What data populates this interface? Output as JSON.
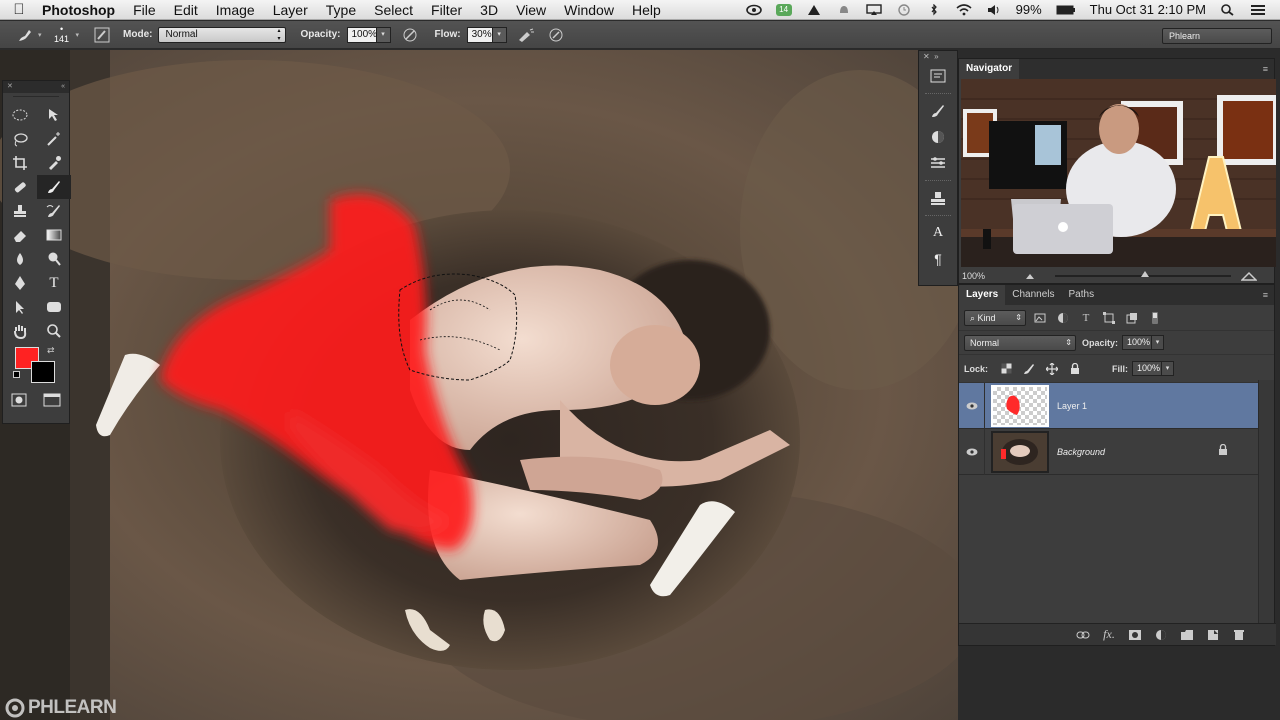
{
  "menubar": {
    "app": "Photoshop",
    "items": [
      "File",
      "Edit",
      "Image",
      "Layer",
      "Type",
      "Select",
      "Filter",
      "3D",
      "View",
      "Window",
      "Help"
    ],
    "battery": "99%",
    "clock": "Thu Oct 31  2:10 PM",
    "badge": "14"
  },
  "options": {
    "brush_size": "141",
    "mode_label": "Mode:",
    "mode_value": "Normal",
    "opacity_label": "Opacity:",
    "opacity_value": "100%",
    "flow_label": "Flow:",
    "flow_value": "30%",
    "workspace": "Phlearn"
  },
  "navigator": {
    "tab": "Navigator",
    "zoom": "100%"
  },
  "layers": {
    "tabs": [
      "Layers",
      "Channels",
      "Paths"
    ],
    "filter_kind": "Kind",
    "blend_mode": "Normal",
    "opacity_label": "Opacity:",
    "opacity_value": "100%",
    "lock_label": "Lock:",
    "fill_label": "Fill:",
    "fill_value": "100%",
    "items": [
      {
        "name": "Layer 1",
        "selected": true,
        "visible": true,
        "locked": false
      },
      {
        "name": "Background",
        "selected": false,
        "visible": true,
        "locked": true
      }
    ]
  },
  "tools": {
    "foreground_color": "#ff2222",
    "background_color": "#000000",
    "icons": [
      "marquee-icon",
      "move-icon",
      "lasso-icon",
      "magic-wand-icon",
      "crop-icon",
      "eyedropper-icon",
      "healing-icon",
      "brush-icon",
      "stamp-icon",
      "history-brush-icon",
      "eraser-icon",
      "gradient-icon",
      "blur-icon",
      "dodge-icon",
      "pen-icon",
      "type-icon",
      "path-select-icon",
      "shape-icon",
      "hand-icon",
      "zoom-icon"
    ]
  },
  "watermark": "PHLEARN"
}
